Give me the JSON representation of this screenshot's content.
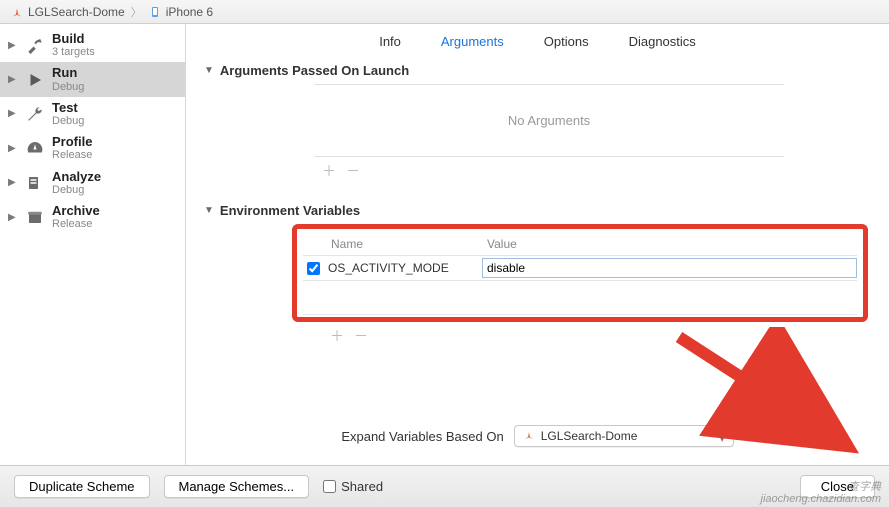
{
  "breadcrumb": {
    "project": "LGLSearch-Dome",
    "device": "iPhone 6"
  },
  "sidebar": [
    {
      "title": "Build",
      "sub": "3 targets",
      "icon": "hammer"
    },
    {
      "title": "Run",
      "sub": "Debug",
      "icon": "play",
      "selected": true
    },
    {
      "title": "Test",
      "sub": "Debug",
      "icon": "wrench"
    },
    {
      "title": "Profile",
      "sub": "Release",
      "icon": "gauge"
    },
    {
      "title": "Analyze",
      "sub": "Debug",
      "icon": "analyze"
    },
    {
      "title": "Archive",
      "sub": "Release",
      "icon": "archive"
    }
  ],
  "tabs": {
    "info": "Info",
    "arguments": "Arguments",
    "options": "Options",
    "diagnostics": "Diagnostics",
    "active": "arguments"
  },
  "sections": {
    "args_title": "Arguments Passed On Launch",
    "args_placeholder": "No Arguments",
    "env_title": "Environment Variables",
    "env_headers": {
      "name": "Name",
      "value": "Value"
    },
    "env_rows": [
      {
        "checked": true,
        "name": "OS_ACTIVITY_MODE",
        "value": "disable"
      }
    ]
  },
  "expand": {
    "label": "Expand Variables Based On",
    "value": "LGLSearch-Dome"
  },
  "footer": {
    "duplicate": "Duplicate Scheme",
    "manage": "Manage Schemes...",
    "shared": "Shared",
    "close": "Close"
  },
  "watermark": {
    "line1": "查字典",
    "line2": "jiaocheng.chazidian.com"
  }
}
